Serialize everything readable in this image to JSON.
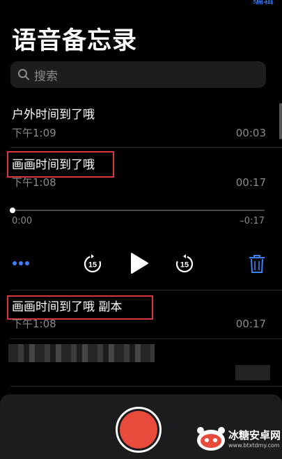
{
  "header": {
    "edit_label": "编辑",
    "title": "语音备忘录"
  },
  "search": {
    "placeholder": "搜索"
  },
  "recordings": [
    {
      "title": "户外时间到了哦",
      "time": "下午1:09",
      "duration": "00:03"
    },
    {
      "title": "画画时间到了哦",
      "time": "下午1:08",
      "duration": "00:17"
    },
    {
      "title": "画画时间到了哦 副本",
      "time": "下午1:08",
      "duration": "00:17"
    }
  ],
  "player": {
    "elapsed": "0:00",
    "remaining": "–0:17",
    "skip_back": "15",
    "skip_forward": "15",
    "progress": 0
  },
  "watermark": {
    "text": "冰糖安卓网",
    "url": "www.btxtdmy.com"
  },
  "colors": {
    "accent": "#3a82f7",
    "record": "#e84b3c",
    "highlight_box": "#d8363d"
  },
  "icons": [
    "search-icon",
    "more-icon",
    "skip-back-15-icon",
    "play-icon",
    "skip-forward-15-icon",
    "trash-icon",
    "record-icon"
  ]
}
